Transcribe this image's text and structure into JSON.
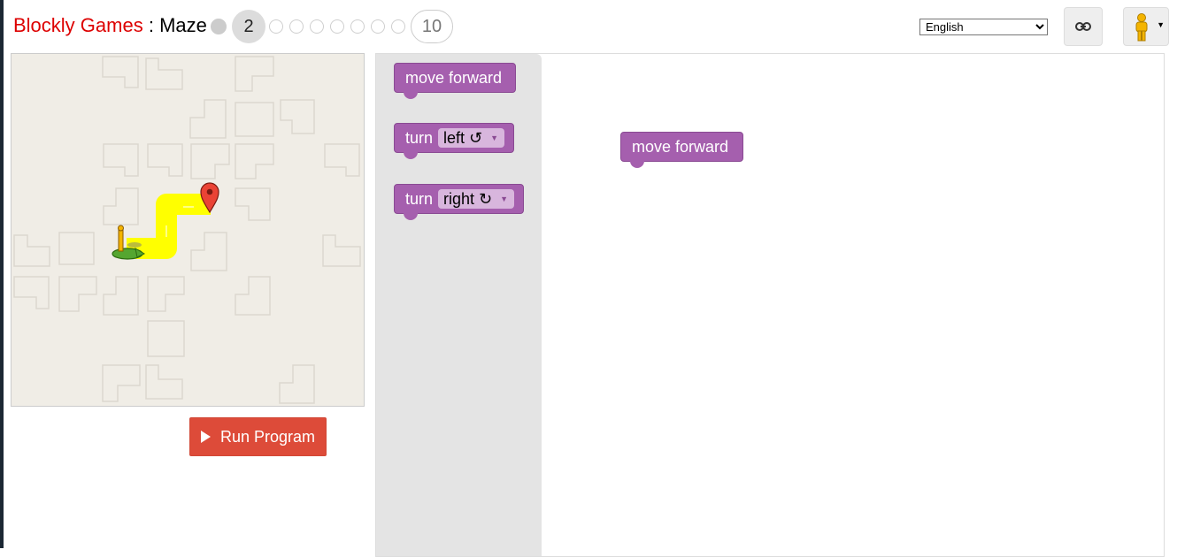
{
  "header": {
    "brand": "Blockly Games",
    "separator": " : ",
    "game": "Maze",
    "current_level": "2",
    "last_level": "10",
    "language": "English",
    "link_icon": "link-icon",
    "avatar_icon": "pegman-icon",
    "avatar_caret": "▼"
  },
  "maze": {
    "run_label": "Run Program",
    "path_color": "#ffff00",
    "start_icon": "pegman-start-icon",
    "finish_icon": "marker-icon"
  },
  "toolbox": {
    "move_forward": "move forward",
    "turn_left_word": "turn",
    "turn_left_value": "left ↺",
    "turn_right_word": "turn",
    "turn_right_value": "right ↻"
  },
  "workspace": {
    "block_label": "move forward"
  },
  "colors": {
    "block": "#a55fae",
    "run_button": "#dd4b39",
    "brand": "#dd0000"
  }
}
